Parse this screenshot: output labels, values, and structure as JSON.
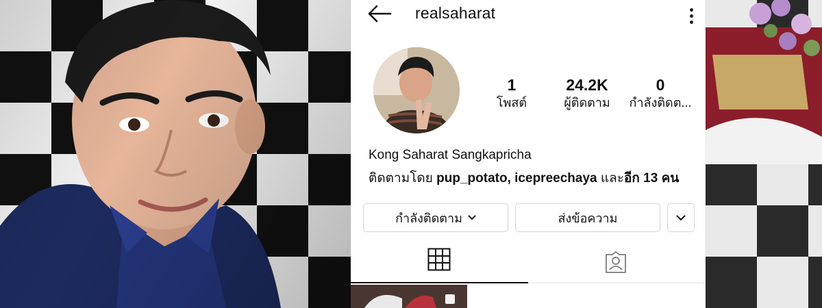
{
  "profile": {
    "username": "realsaharat",
    "full_name": "Kong Saharat Sangkapricha",
    "stats": {
      "posts_count": "1",
      "posts_label": "โพสต์",
      "followers_count": "24.2K",
      "followers_label": "ผู้ติดตาม",
      "following_count": "0",
      "following_label": "กำลังติดต..."
    },
    "followed_by": {
      "prefix": "ติดตามโดย",
      "users": "pup_potato, icepreechaya",
      "suffix_and": "และ",
      "others": "อีก 13 คน"
    }
  },
  "actions": {
    "following_label": "กำลังติดตาม",
    "message_label": "ส่งข้อความ"
  },
  "icons": {
    "back": "back-arrow-icon",
    "more": "more-vertical-icon",
    "grid": "grid-icon",
    "tagged": "tagged-person-icon",
    "chevron": "chevron-down-icon"
  },
  "colors": {
    "text": "#111111",
    "border": "#d4d4d4",
    "background": "#ffffff"
  }
}
